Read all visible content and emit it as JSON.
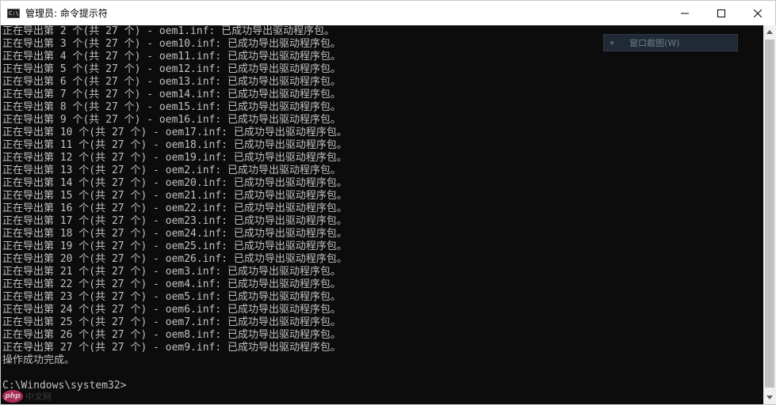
{
  "window": {
    "title": "管理员: 命令提示符",
    "icon_label": "C:\\"
  },
  "controls": {
    "minimize_icon": "minimize-icon",
    "maximize_icon": "maximize-icon",
    "close_icon": "close-icon"
  },
  "console": {
    "lines": [
      "正在导出第 2 个(共 27 个) - oem1.inf: 已成功导出驱动程序包。",
      "正在导出第 3 个(共 27 个) - oem10.inf: 已成功导出驱动程序包。",
      "正在导出第 4 个(共 27 个) - oem11.inf: 已成功导出驱动程序包。",
      "正在导出第 5 个(共 27 个) - oem12.inf: 已成功导出驱动程序包。",
      "正在导出第 6 个(共 27 个) - oem13.inf: 已成功导出驱动程序包。",
      "正在导出第 7 个(共 27 个) - oem14.inf: 已成功导出驱动程序包。",
      "正在导出第 8 个(共 27 个) - oem15.inf: 已成功导出驱动程序包。",
      "正在导出第 9 个(共 27 个) - oem16.inf: 已成功导出驱动程序包。",
      "正在导出第 10 个(共 27 个) - oem17.inf: 已成功导出驱动程序包。",
      "正在导出第 11 个(共 27 个) - oem18.inf: 已成功导出驱动程序包。",
      "正在导出第 12 个(共 27 个) - oem19.inf: 已成功导出驱动程序包。",
      "正在导出第 13 个(共 27 个) - oem2.inf: 已成功导出驱动程序包。",
      "正在导出第 14 个(共 27 个) - oem20.inf: 已成功导出驱动程序包。",
      "正在导出第 15 个(共 27 个) - oem21.inf: 已成功导出驱动程序包。",
      "正在导出第 16 个(共 27 个) - oem22.inf: 已成功导出驱动程序包。",
      "正在导出第 17 个(共 27 个) - oem23.inf: 已成功导出驱动程序包。",
      "正在导出第 18 个(共 27 个) - oem24.inf: 已成功导出驱动程序包。",
      "正在导出第 19 个(共 27 个) - oem25.inf: 已成功导出驱动程序包。",
      "正在导出第 20 个(共 27 个) - oem26.inf: 已成功导出驱动程序包。",
      "正在导出第 21 个(共 27 个) - oem3.inf: 已成功导出驱动程序包。",
      "正在导出第 22 个(共 27 个) - oem4.inf: 已成功导出驱动程序包。",
      "正在导出第 23 个(共 27 个) - oem5.inf: 已成功导出驱动程序包。",
      "正在导出第 24 个(共 27 个) - oem6.inf: 已成功导出驱动程序包。",
      "正在导出第 25 个(共 27 个) - oem7.inf: 已成功导出驱动程序包。",
      "正在导出第 26 个(共 27 个) - oem8.inf: 已成功导出驱动程序包。",
      "正在导出第 27 个(共 27 个) - oem9.inf: 已成功导出驱动程序包。",
      "操作成功完成。",
      "",
      "C:\\Windows\\system32>"
    ]
  },
  "tooltip": {
    "label": "窗口截图(W)"
  },
  "watermark": {
    "logo": "php",
    "text": "中文网"
  },
  "colors": {
    "console_bg": "#0c0c0c",
    "console_text": "#c0c0c0",
    "titlebar_bg": "#ffffff"
  }
}
